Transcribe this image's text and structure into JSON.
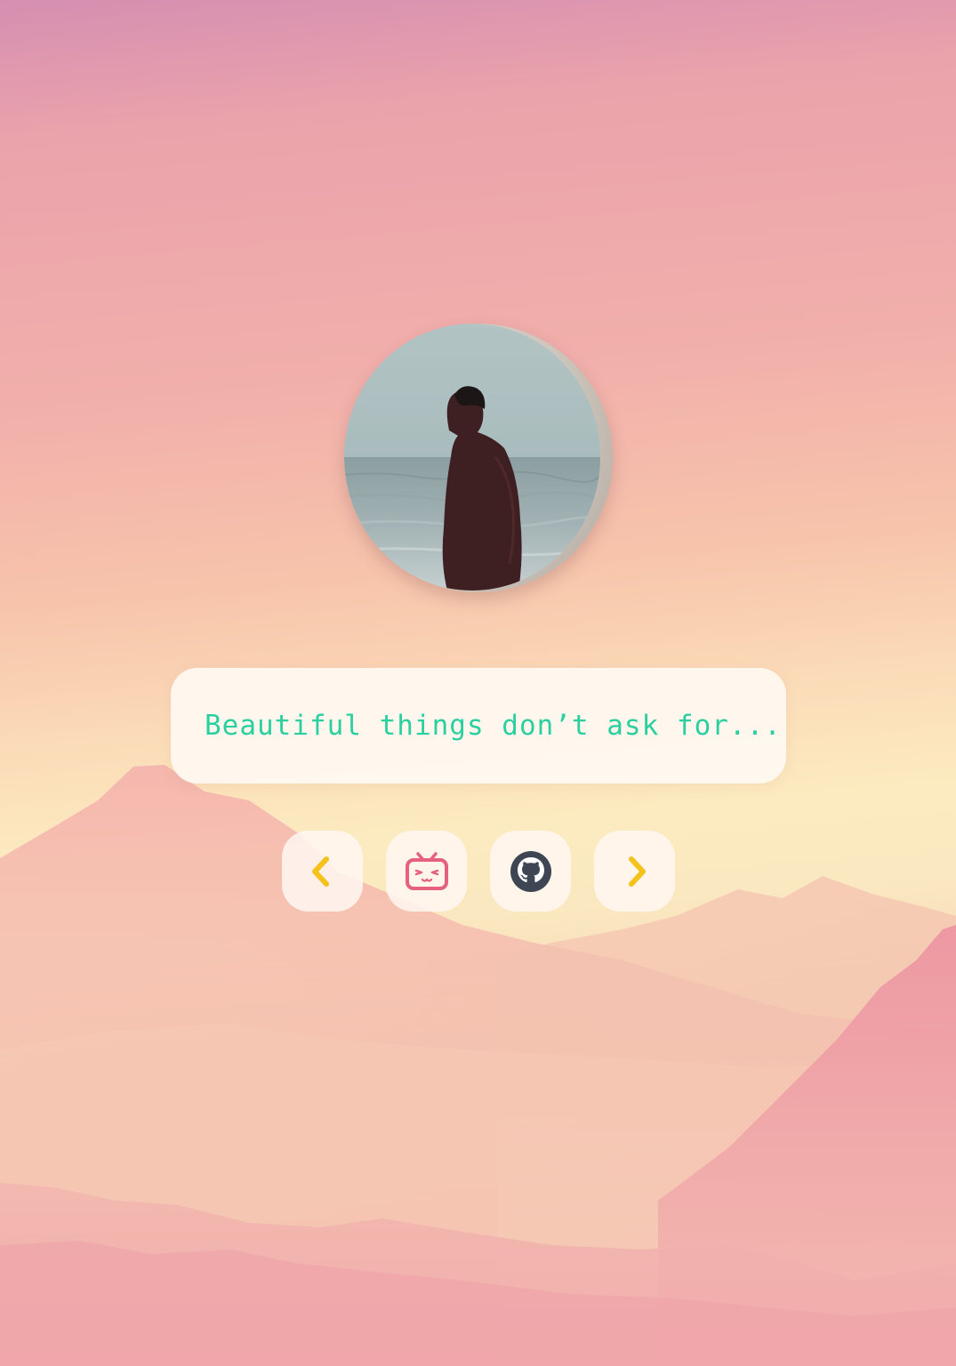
{
  "quote": {
    "text": "Beautiful things don’t ask for..."
  },
  "avatar": {
    "alt": "profile photo of a person standing by the sea"
  },
  "buttons": [
    {
      "name": "previous",
      "icon": "chevron-left-icon",
      "color": "#f5c21b"
    },
    {
      "name": "bilibili",
      "icon": "bilibili-tv-icon",
      "color": "#e5617e"
    },
    {
      "name": "github",
      "icon": "github-icon",
      "color": "#3e4653"
    },
    {
      "name": "next",
      "icon": "chevron-right-icon",
      "color": "#f5c21b"
    }
  ],
  "colors": {
    "quote_text": "#2ccf9f",
    "card_background": "#fffaf4",
    "accent_yellow": "#f5c21b",
    "accent_pink": "#e5617e"
  }
}
